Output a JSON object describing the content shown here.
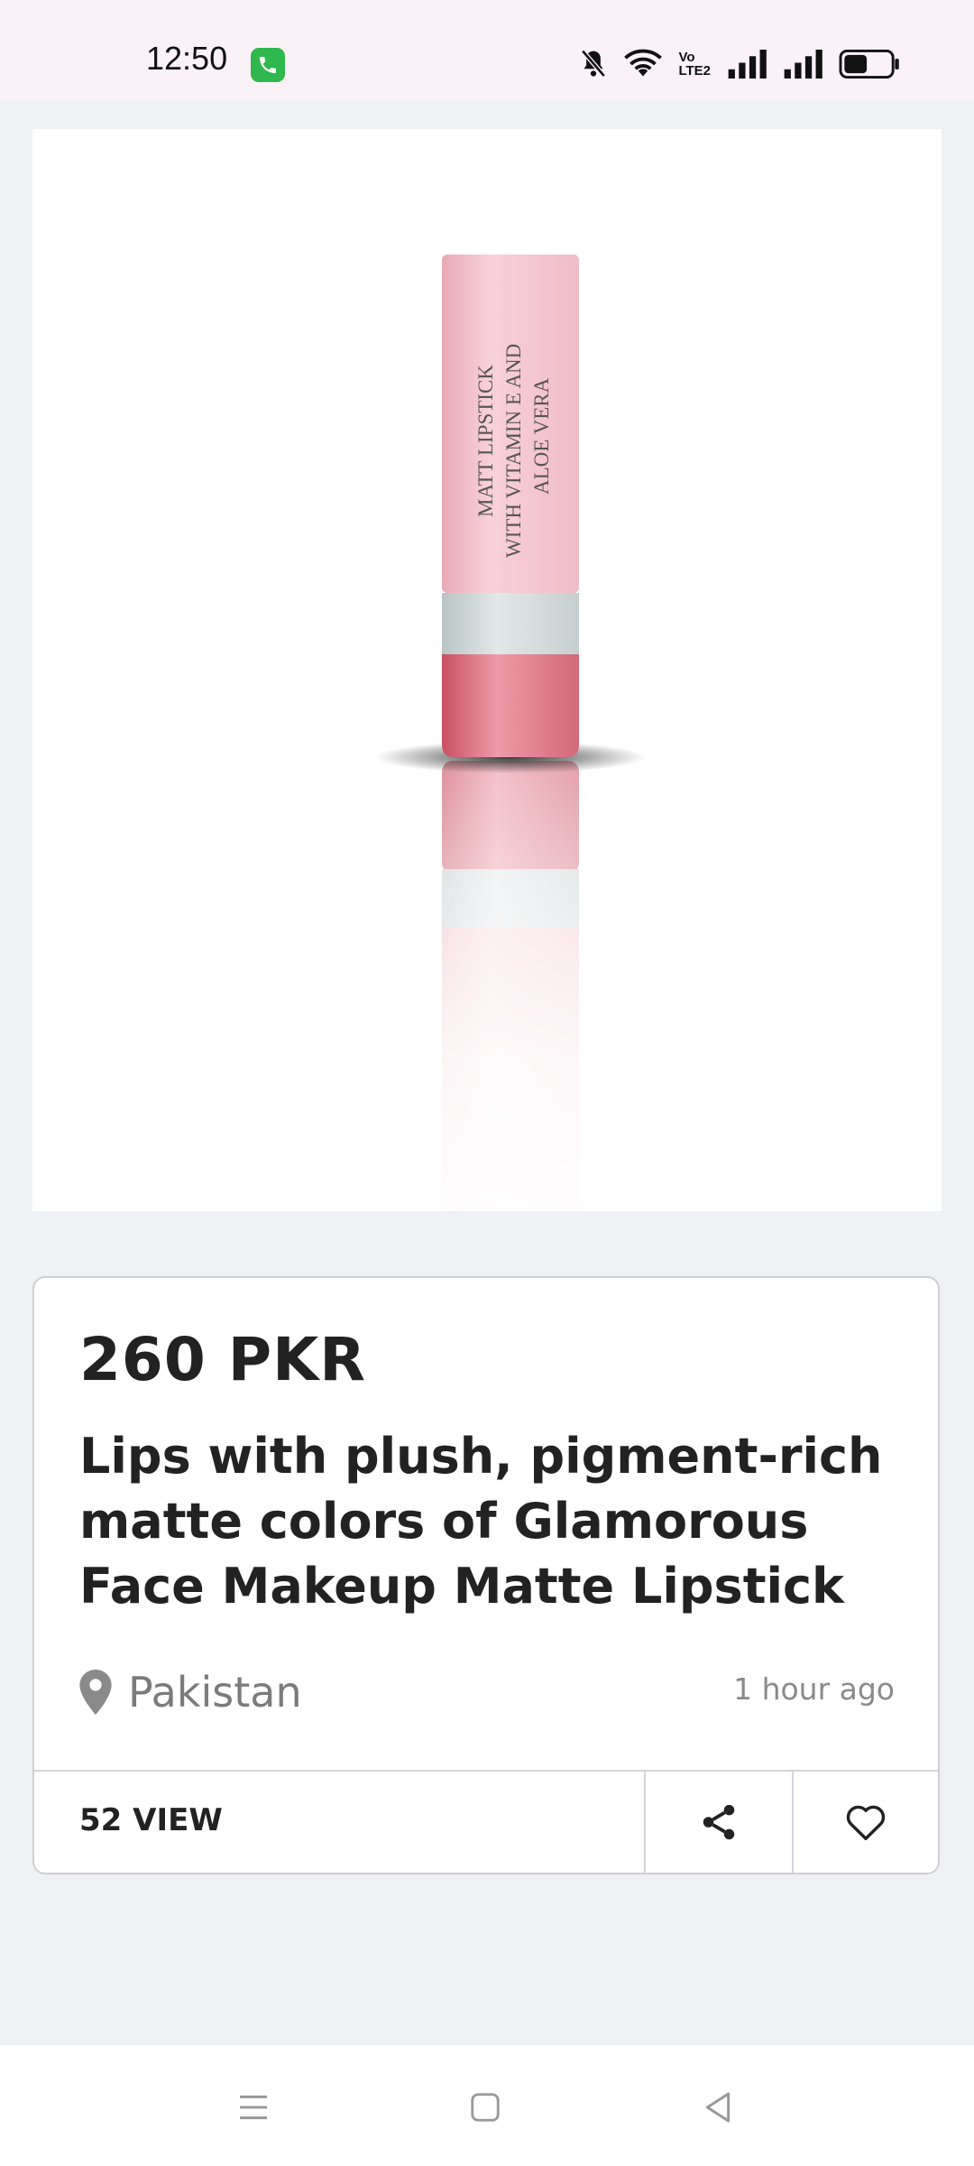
{
  "status": {
    "time": "12:50",
    "icons": [
      "call-icon",
      "mute-icon",
      "wifi-icon",
      "volte-icon",
      "signal-icon",
      "signal-icon",
      "battery-icon"
    ],
    "volte_line1": "Vo",
    "volte_line2": "LTE2",
    "battery_level": 0.5
  },
  "product": {
    "image_text": [
      "MATT LIPSTICK",
      "WITH VITAMIN E AND",
      "ALOE VERA"
    ],
    "price": "260 PKR",
    "title": "Lips with plush, pigment-rich matte colors of Glamorous Face Makeup Matte Lipstick",
    "location": "Pakistan",
    "posted": "1 hour ago",
    "views": "52 VIEW"
  },
  "actions": {
    "share_icon": "share-icon",
    "favorite_icon": "heart-icon"
  },
  "navigation": {
    "buttons": [
      "menu-icon",
      "home-icon",
      "back-icon"
    ]
  },
  "colors": {
    "status_bar_bg": "#fbf2f8",
    "page_bg": "#f0f1f5",
    "call_badge": "#2fb84d",
    "lipstick_pink": "#f4c6d0",
    "lipstick_red": "#d85a6c"
  }
}
